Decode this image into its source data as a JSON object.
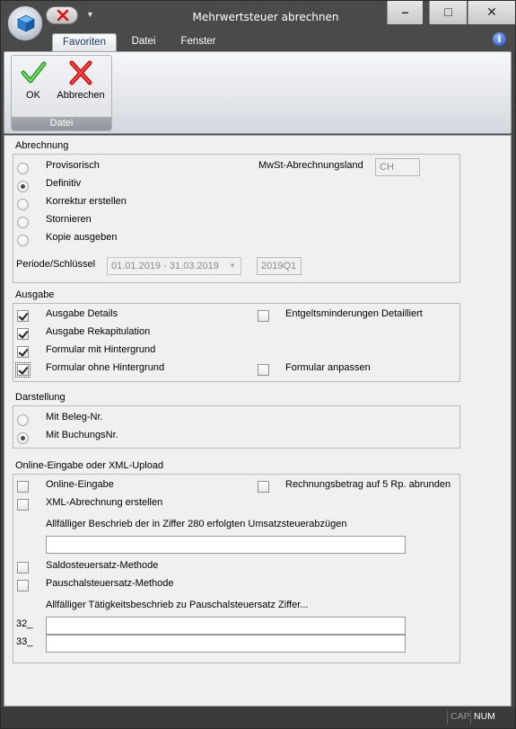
{
  "window": {
    "title": "Mehrwertsteuer abrechnen",
    "min_glyph": "–",
    "max_glyph": "□",
    "close_glyph": "✕"
  },
  "ribbon": {
    "tabs": [
      "Favoriten",
      "Datei",
      "Fenster"
    ],
    "active_tab": "Favoriten",
    "help_glyph": "i",
    "group_label": "Datei",
    "ok_label": "OK",
    "cancel_label": "Abbrechen"
  },
  "abrechnung": {
    "title": "Abrechnung",
    "options": [
      "Provisorisch",
      "Definitiv",
      "Korrektur erstellen",
      "Stornieren",
      "Kopie ausgeben"
    ],
    "selected": "Definitiv",
    "country_label": "MwSt-Abrechnungsland",
    "country_value": "CH",
    "period_label": "Periode/Schlüssel",
    "period_value": "01.01.2019 - 31.03.2019",
    "key_value": "2019Q1"
  },
  "ausgabe": {
    "title": "Ausgabe",
    "ausgabe_details": {
      "label": "Ausgabe Details",
      "checked": true
    },
    "ausgabe_rekapitulation": {
      "label": "Ausgabe Rekapitulation",
      "checked": true
    },
    "formular_mit_hintergrund": {
      "label": "Formular mit Hintergrund",
      "checked": true
    },
    "formular_ohne_hintergrund": {
      "label": "Formular ohne Hintergrund",
      "checked": true
    },
    "entgeltsminderungen_detailliert": {
      "label": "Entgeltsminderungen Detailliert",
      "checked": false
    },
    "formular_anpassen": {
      "label": "Formular anpassen",
      "checked": false
    }
  },
  "darstellung": {
    "title": "Darstellung",
    "options": [
      "Mit Beleg-Nr.",
      "Mit BuchungsNr."
    ],
    "selected": "Mit BuchungsNr."
  },
  "online": {
    "title": "Online-Eingabe oder XML-Upload",
    "online_eingabe": {
      "label": "Online-Eingabe",
      "checked": false
    },
    "rechnungsbetrag_abrunden": {
      "label": "Rechnungsbetrag auf 5 Rp. abrunden",
      "checked": false
    },
    "xml_abrechnung": {
      "label": "XML-Abrechnung erstellen",
      "checked": false
    },
    "beschrieb_label": "Allfälliger Beschrieb der in Ziffer 280 erfolgten Umsatzsteuerabzügen",
    "beschrieb_value": "",
    "saldosteuersatz": {
      "label": "Saldosteuersatz-Methode",
      "checked": false
    },
    "pauschalsteuersatz": {
      "label": "Pauschalsteuersatz-Methode",
      "checked": false
    },
    "taetigkeit_label": "Allfälliger Tätigkeitsbeschrieb zu Pauschalsteuersatz Ziffer...",
    "ziffer_32_label": "32_",
    "ziffer_32_value": "",
    "ziffer_33_label": "33_",
    "ziffer_33_value": ""
  },
  "statusbar": {
    "cap": "CAP",
    "num": "NUM"
  }
}
